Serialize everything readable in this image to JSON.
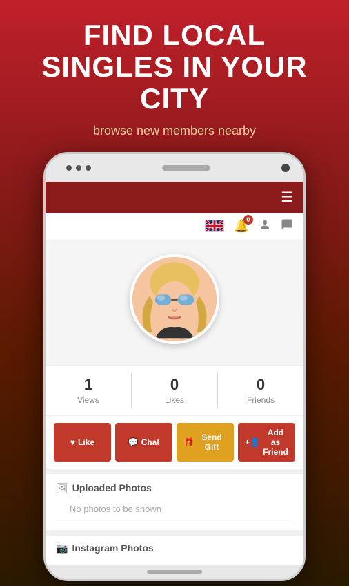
{
  "headline": {
    "title": "FIND LOCAL SINGLES IN YOUR CITY",
    "subtitle": "browse new members nearby"
  },
  "app": {
    "header": {
      "hamburger_label": "☰"
    },
    "nav": {
      "notification_count": "0",
      "icons": [
        "flag-uk",
        "bell",
        "person",
        "chat-bubble"
      ]
    },
    "profile": {
      "stats": [
        {
          "value": "1",
          "label": "Views"
        },
        {
          "value": "0",
          "label": "Likes"
        },
        {
          "value": "0",
          "label": "Friends"
        }
      ]
    },
    "action_buttons": [
      {
        "key": "like",
        "label": "Like",
        "icon": "❤"
      },
      {
        "key": "chat",
        "label": "Chat",
        "icon": "💬"
      },
      {
        "key": "gift",
        "label": "Send Gift",
        "icon": "🎁"
      },
      {
        "key": "friend",
        "label": "Add as Friend",
        "icon": "👤"
      }
    ],
    "uploaded_photos": {
      "section_title": "Uploaded Photos",
      "empty_text": "No photos to be shown"
    },
    "instagram_photos": {
      "section_title": "Instagram Photos"
    }
  }
}
